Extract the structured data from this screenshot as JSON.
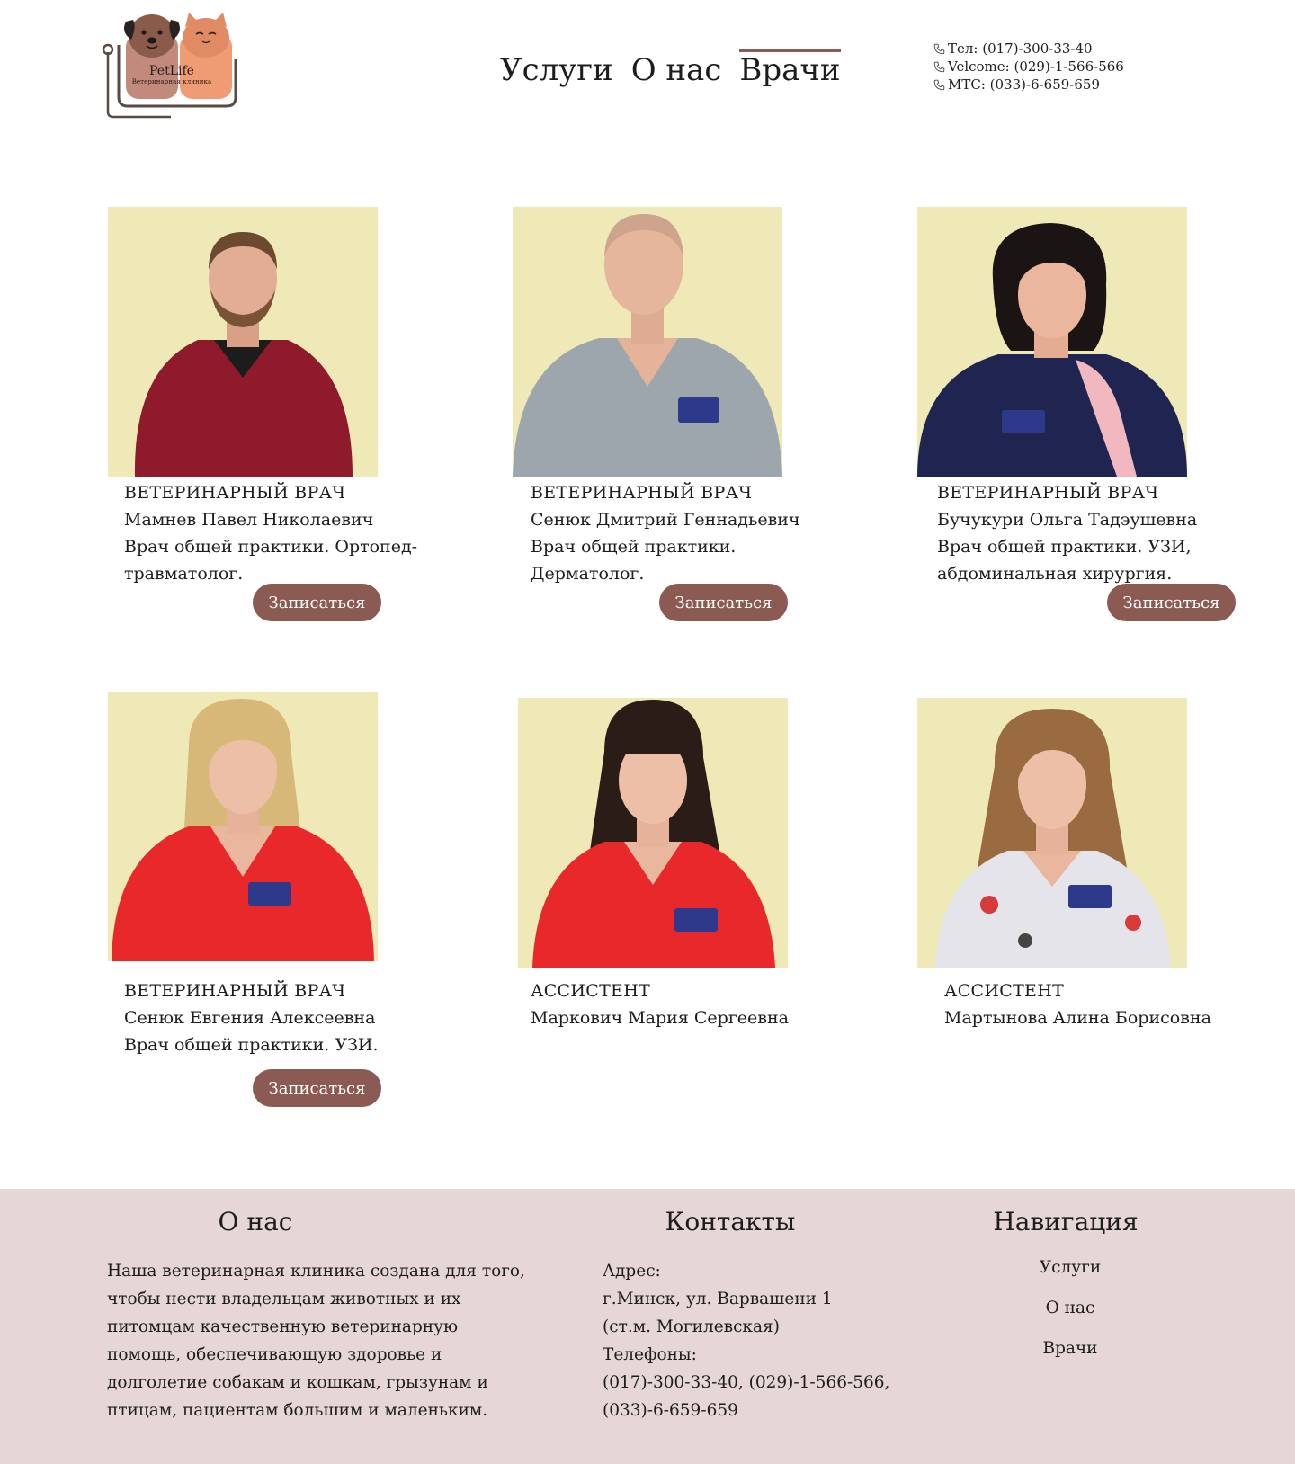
{
  "header": {
    "logo": {
      "name": "PetLife",
      "subtitle": "Ветеринарная клиника"
    },
    "nav": [
      {
        "label": "Услуги",
        "active": false
      },
      {
        "label": "О нас",
        "active": false
      },
      {
        "label": "Врачи",
        "active": true
      }
    ],
    "phones": [
      "Тел: (017)-300-33-40",
      "Velcome: (029)-1-566-566",
      "МТС: (033)-6-659-659"
    ]
  },
  "doctors": [
    {
      "role": "ВЕТЕРИНАРНЫЙ ВРАЧ",
      "name": "Мамнев Павел Николаевич",
      "desc_line1": "Врач общей практики. Ортопед-",
      "desc_line2": "травматолог.",
      "button": "Записаться"
    },
    {
      "role": "ВЕТЕРИНАРНЫЙ ВРАЧ",
      "name": "Сенюк Дмитрий Геннадьевич",
      "desc_line1": "Врач общей практики.",
      "desc_line2": "Дерматолог.",
      "button": "Записаться"
    },
    {
      "role": "ВЕТЕРИНАРНЫЙ ВРАЧ",
      "name": "Бучукури Ольга Тадэушевна",
      "desc_line1": "Врач общей практики. УЗИ,",
      "desc_line2": "абдоминальная хирургия.",
      "button": "Записаться"
    },
    {
      "role": "ВЕТЕРИНАРНЫЙ ВРАЧ",
      "name": "Сенюк Евгения Алексеевна",
      "desc_line1": "Врач общей практики. УЗИ.",
      "desc_line2": "",
      "button": "Записаться"
    },
    {
      "role": "АССИСТЕНТ",
      "name": "Маркович Мария Сергеевна",
      "desc_line1": "",
      "desc_line2": "",
      "button": ""
    },
    {
      "role": "АССИСТЕНТ",
      "name": "Мартынова Алина Борисовна",
      "desc_line1": "",
      "desc_line2": "",
      "button": ""
    }
  ],
  "footer": {
    "about": {
      "title": "О нас",
      "lines": [
        "Наша ветеринарная клиника создана для того,",
        "чтобы нести владельцам животных и их",
        "питомцам качественную ветеринарную",
        "помощь, обеспечивающую здоровье и",
        "долголетие собакам и кошкам, грызунам и",
        "птицам, пациентам большим и маленьким."
      ]
    },
    "contacts": {
      "title": "Контакты",
      "lines": [
        "Адрес:",
        "г.Минск, ул. Варвашени 1",
        "(ст.м. Могилевская)",
        "Телефоны:",
        "(017)-300-33-40, (029)-1-566-566,",
        "(033)-6-659-659"
      ]
    },
    "navigation": {
      "title": "Навигация",
      "links": [
        "Услуги",
        "О нас",
        "Врачи"
      ]
    }
  },
  "colors": {
    "accent": "#8b5a52",
    "footer_bg": "#e6d6d6",
    "photo_bg": "#efe9b8"
  }
}
